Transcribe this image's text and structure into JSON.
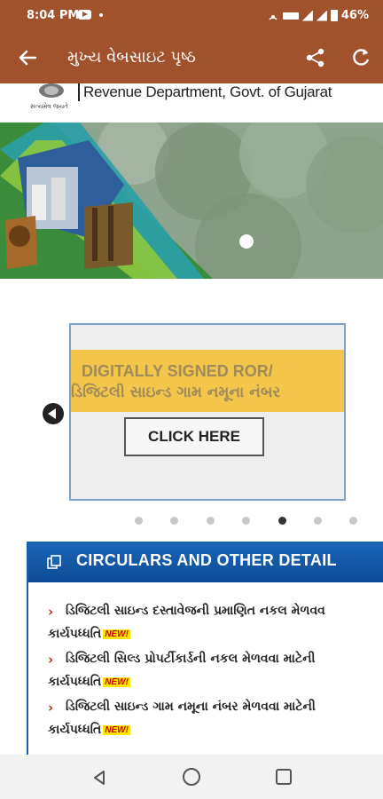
{
  "status_bar": {
    "time": "8:04 PM",
    "battery": "46%",
    "icons": [
      "youtube-icon",
      "dot-icon",
      "hotspot-icon",
      "4g-icon",
      "signal-icon",
      "signal-icon",
      "battery-icon"
    ]
  },
  "app_bar": {
    "title": "મુખ્ય વેબસાઇટ પૃષ્ઠ",
    "icons": [
      "back-arrow-icon",
      "share-icon",
      "refresh-icon"
    ]
  },
  "header": {
    "department": "Revenue Department, Govt. of Gujarat",
    "emblem_caption": "સત્યમેવ જયતે"
  },
  "carousel": {
    "line1": "DIGITALLY SIGNED ROR/",
    "line2": "ડિજિટલી સાઇન્ડ ગામ નમૂના નંબર",
    "button_label": "CLICK HERE",
    "dot_count": 7,
    "active_dot_index": 4
  },
  "circulars": {
    "title": "CIRCULARS AND OTHER DETAIL",
    "items": [
      {
        "line1": "ડિજિટલી સાઇન્ડ દસ્તાવેજની પ્રમાણિત નકલ મેળવવ",
        "line2": "કાર્યપધ્ધતિ",
        "badge": "NEW!"
      },
      {
        "line1": "ડિજિટલી સિલ્ડ પ્રોપર્ટીકાર્ડની નકલ મેળવવા માટેની",
        "line2": "કાર્યપધ્ધતિ",
        "badge": "NEW!"
      },
      {
        "line1": "ડિજિટલી સાઇન્ડ ગામ નમૂના નંબર મેળવવા માટેની",
        "line2": "કાર્યપધ્ધતિ",
        "badge": "NEW!"
      }
    ]
  },
  "colors": {
    "app_bar": "#a0522d",
    "circulars_header": "#1a64b6",
    "carousel_band": "#f3c64b",
    "new_badge_bg": "#ffe600"
  }
}
